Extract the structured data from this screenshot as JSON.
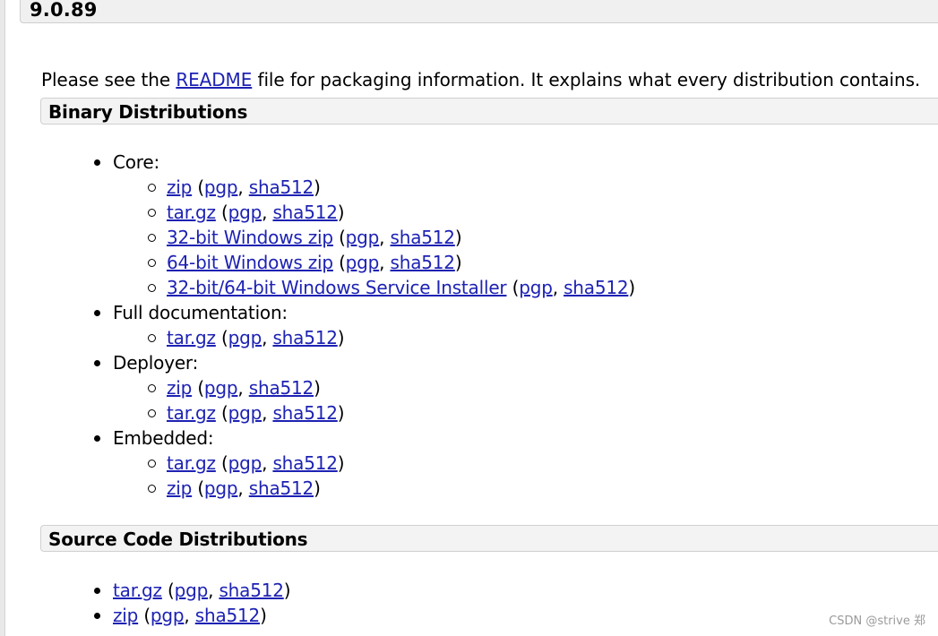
{
  "version": "9.0.89",
  "intro": {
    "before": "Please see the ",
    "link": "README",
    "after": " file for packaging information. It explains what every distribution contains."
  },
  "binary": {
    "title": "Binary Distributions",
    "core_label": "Core:",
    "core": [
      {
        "name": "zip",
        "pgp": "pgp",
        "sha": "sha512"
      },
      {
        "name": "tar.gz",
        "pgp": "pgp",
        "sha": "sha512"
      },
      {
        "name": "32-bit Windows zip",
        "pgp": "pgp",
        "sha": "sha512"
      },
      {
        "name": "64-bit Windows zip",
        "pgp": "pgp",
        "sha": "sha512"
      },
      {
        "name": "32-bit/64-bit Windows Service Installer",
        "pgp": "pgp",
        "sha": "sha512"
      }
    ],
    "docs_label": "Full documentation:",
    "docs": [
      {
        "name": "tar.gz",
        "pgp": "pgp",
        "sha": "sha512"
      }
    ],
    "deployer_label": "Deployer:",
    "deployer": [
      {
        "name": "zip",
        "pgp": "pgp",
        "sha": "sha512"
      },
      {
        "name": "tar.gz",
        "pgp": "pgp",
        "sha": "sha512"
      }
    ],
    "embedded_label": "Embedded:",
    "embedded": [
      {
        "name": "tar.gz",
        "pgp": "pgp",
        "sha": "sha512"
      },
      {
        "name": "zip",
        "pgp": "pgp",
        "sha": "sha512"
      }
    ]
  },
  "source": {
    "title": "Source Code Distributions",
    "items": [
      {
        "name": "tar.gz",
        "pgp": "pgp",
        "sha": "sha512"
      },
      {
        "name": "zip",
        "pgp": "pgp",
        "sha": "sha512"
      }
    ]
  },
  "punct": {
    "open": " (",
    "sep": ", ",
    "close": ")"
  },
  "watermark": "CSDN @strive 郑"
}
